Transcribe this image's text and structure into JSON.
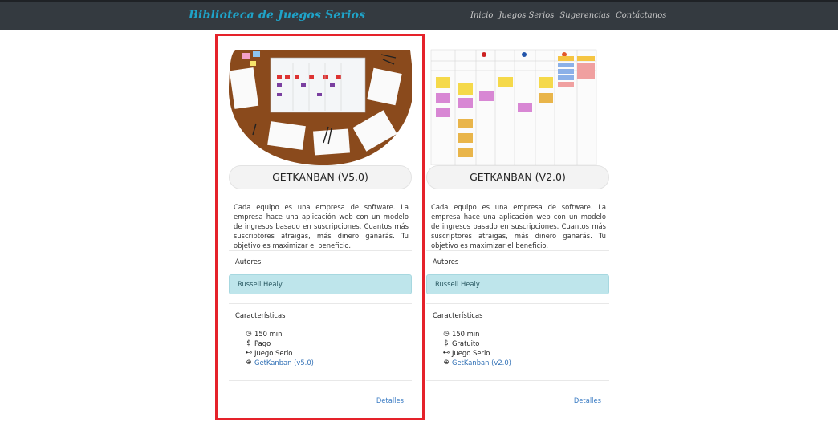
{
  "navbar": {
    "brand": "Biblioteca de Juegos Serios",
    "links": [
      "Inicio",
      "Juegos Serios",
      "Sugerencias",
      "Contáctanos"
    ]
  },
  "cards": [
    {
      "title": "GETKANBAN (V5.0)",
      "description": "Cada equipo es una empresa de software. La empresa hace una aplicación web con un modelo de ingresos basado en suscripciones. Cuantos más suscriptores atraigas, más dinero ganarás. Tu objetivo es maximizar el beneficio.",
      "authors_label": "Autores",
      "author": "Russell Healy",
      "features_label": "Características",
      "features": {
        "duration": "150 min",
        "price": "Pago",
        "type": "Juego Serio",
        "link": "GetKanban (v5.0)"
      },
      "details": "Detalles"
    },
    {
      "title": "GETKANBAN (V2.0)",
      "description": "Cada equipo es una empresa de software. La empresa hace una aplicación web con un modelo de ingresos basado en suscripciones. Cuantos más suscriptores atraigas, más dinero ganarás. Tu objetivo es maximizar el beneficio.",
      "authors_label": "Autores",
      "author": "Russell Healy",
      "features_label": "Características",
      "features": {
        "duration": "150 min",
        "price": "Gratuito",
        "type": "Juego Serio",
        "link": "GetKanban (v2.0)"
      },
      "details": "Detalles"
    }
  ],
  "colors": {
    "navbar_bg": "#343a40",
    "brand": "#1fa3c8",
    "author_box": "#bee5eb",
    "link": "#3c7dc4",
    "highlight": "#e5222a"
  },
  "icons": [
    "clock-icon",
    "dollar-icon",
    "gamepad-icon",
    "globe-icon"
  ]
}
